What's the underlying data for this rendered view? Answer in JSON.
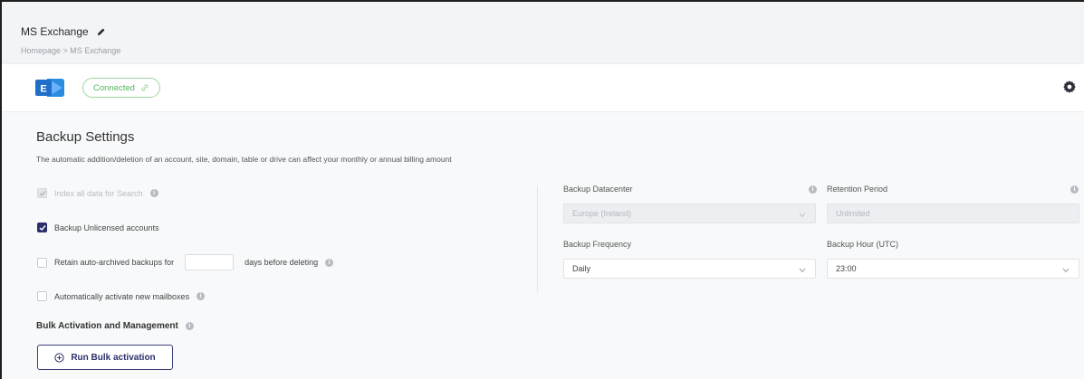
{
  "header": {
    "title": "MS Exchange",
    "breadcrumb": "Homepage > MS Exchange"
  },
  "connection": {
    "status": "Connected",
    "logo_letter": "E",
    "status_color": "#58b15d"
  },
  "backup_settings": {
    "title": "Backup Settings",
    "description": "The automatic addition/deletion of an account, site, domain, table or drive can affect your monthly or annual billing amount",
    "options": {
      "index_all_data": {
        "label": "Index all data for Search",
        "checked": true,
        "disabled": true
      },
      "backup_unlicensed": {
        "label": "Backup Unlicensed accounts",
        "checked": true,
        "disabled": false
      },
      "retain_archived": {
        "label_before": "Retain auto-archived backups for",
        "value": "",
        "label_after": "days before deleting",
        "checked": false
      },
      "auto_activate": {
        "label": "Automatically activate new mailboxes",
        "checked": false
      }
    },
    "fields": {
      "datacenter": {
        "label": "Backup Datacenter",
        "value": "Europe (Ireland)",
        "disabled": true
      },
      "retention": {
        "label": "Retention Period",
        "value": "Unlimited",
        "disabled": true
      },
      "frequency": {
        "label": "Backup Frequency",
        "value": "Daily"
      },
      "hour": {
        "label": "Backup Hour (UTC)",
        "value": "23:00"
      }
    }
  },
  "bulk": {
    "title": "Bulk Activation and Management",
    "run_button": "Run Bulk activation"
  },
  "colors": {
    "accent": "#2d2f6c",
    "exchange_blue": "#1f6fc9"
  }
}
